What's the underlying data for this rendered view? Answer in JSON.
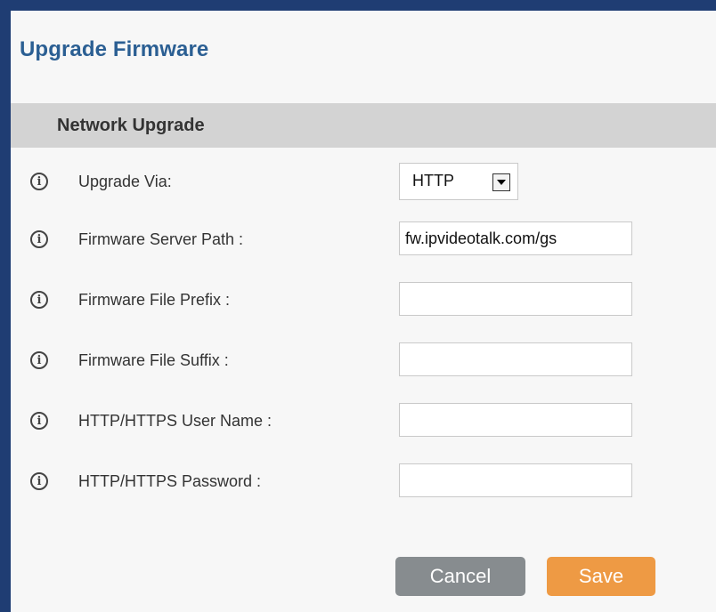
{
  "page": {
    "title": "Upgrade Firmware"
  },
  "section": {
    "title": "Network Upgrade"
  },
  "fields": {
    "upgrade_via": {
      "label": "Upgrade Via:",
      "value": "HTTP"
    },
    "server_path": {
      "label": "Firmware Server Path :",
      "value": "fw.ipvideotalk.com/gs"
    },
    "file_prefix": {
      "label": "Firmware File Prefix :",
      "value": ""
    },
    "file_suffix": {
      "label": "Firmware File Suffix :",
      "value": ""
    },
    "user_name": {
      "label": "HTTP/HTTPS User Name :",
      "value": ""
    },
    "password": {
      "label": "HTTP/HTTPS Password :",
      "value": ""
    }
  },
  "icons": {
    "info": "info-circle-icon",
    "dropdown": "dropdown-arrow-icon"
  },
  "buttons": {
    "cancel": "Cancel",
    "save": "Save"
  },
  "colors": {
    "title": "#2b5f93",
    "section_bg": "#d3d3d3",
    "cancel_bg": "#878c8f",
    "save_bg": "#ee9a44",
    "frame": "#1f3d73"
  }
}
